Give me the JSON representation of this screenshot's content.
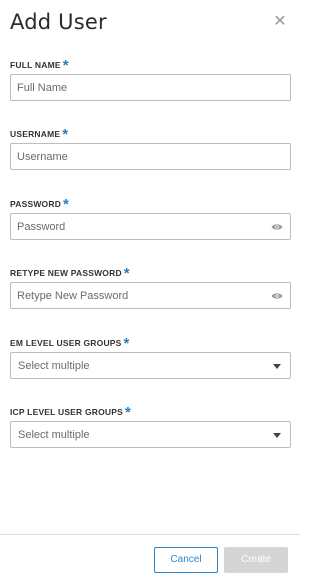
{
  "dialog": {
    "title": "Add User",
    "close_icon": "close-icon"
  },
  "fields": {
    "full_name": {
      "label": "FULL NAME",
      "required": "*",
      "placeholder": "Full Name",
      "value": ""
    },
    "username": {
      "label": "USERNAME",
      "required": "*",
      "placeholder": "Username",
      "value": ""
    },
    "password": {
      "label": "PASSWORD",
      "required": "*",
      "placeholder": "Password",
      "value": "",
      "icon": "eye-icon"
    },
    "retype_password": {
      "label": "RETYPE NEW PASSWORD",
      "required": "*",
      "placeholder": "Retype New Password",
      "value": "",
      "icon": "eye-icon"
    },
    "em_groups": {
      "label": "EM LEVEL USER GROUPS",
      "required": "*",
      "selected": "Select multiple"
    },
    "icp_groups": {
      "label": "ICP LEVEL USER GROUPS",
      "required": "*",
      "selected": "Select multiple"
    }
  },
  "footer": {
    "cancel_label": "Cancel",
    "create_label": "Create"
  },
  "colors": {
    "accent": "#1f7fc6",
    "disabled_button": "#d5d5d5",
    "border": "#bdbdbd"
  }
}
